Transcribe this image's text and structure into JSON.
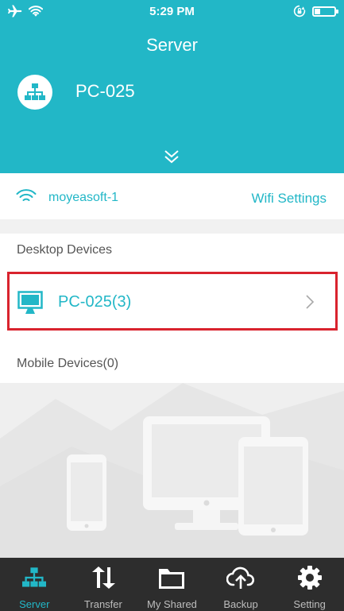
{
  "status": {
    "time": "5:29 PM",
    "battery_level": 0.25
  },
  "header": {
    "title": "Server",
    "server_name": "PC-025"
  },
  "wifi": {
    "ssid": "moyeasoft-1",
    "settings_label": "Wifi Settings"
  },
  "desktop": {
    "section_label": "Desktop Devices",
    "devices": [
      {
        "name": "PC-025(3)"
      }
    ]
  },
  "mobile": {
    "section_label": "Mobile Devices(0)"
  },
  "tabs": [
    {
      "label": "Server",
      "icon": "network-icon",
      "active": true
    },
    {
      "label": "Transfer",
      "icon": "transfer-arrows-icon",
      "active": false
    },
    {
      "label": "My Shared",
      "icon": "folder-icon",
      "active": false
    },
    {
      "label": "Backup",
      "icon": "cloud-upload-icon",
      "active": false
    },
    {
      "label": "Setting",
      "icon": "gear-icon",
      "active": false
    }
  ],
  "colors": {
    "accent": "#22b7c7",
    "highlight": "#d9232e",
    "tabbar": "#2d2d2d"
  }
}
